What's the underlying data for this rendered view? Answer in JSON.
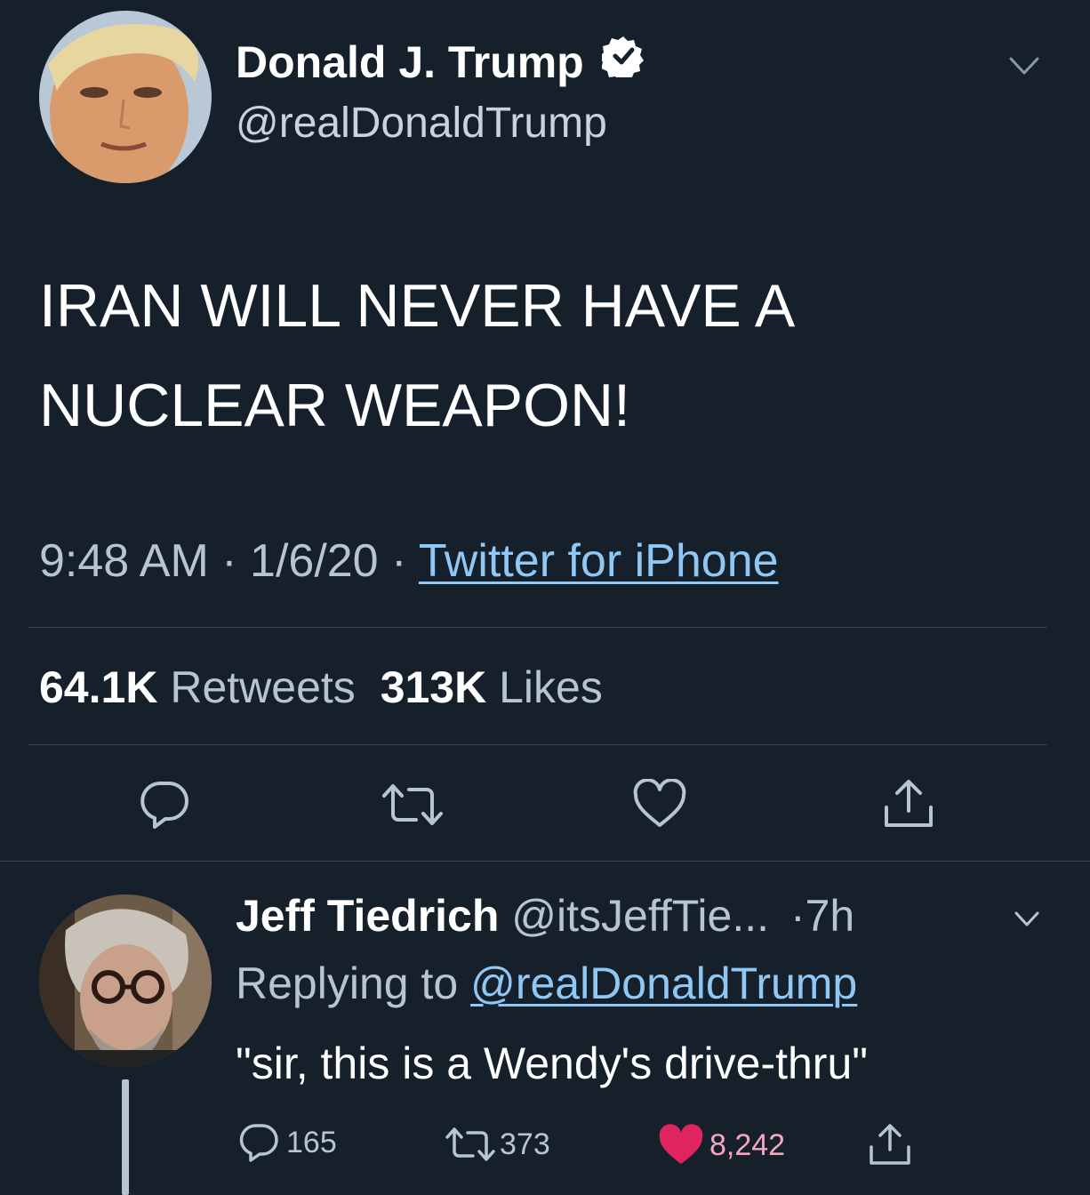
{
  "main_tweet": {
    "author_name": "Donald J. Trump",
    "author_handle": "@realDonaldTrump",
    "verified": true,
    "text_line1": "IRAN WILL NEVER HAVE A",
    "text_line2": "NUCLEAR WEAPON!",
    "time": "9:48 AM",
    "sep1": "·",
    "date": "1/6/20",
    "sep2": "·",
    "source": "Twitter for iPhone",
    "retweets_count": "64.1K",
    "retweets_label": "Retweets",
    "likes_count": "313K",
    "likes_label": "Likes",
    "actions": [
      "reply-icon",
      "retweet-icon",
      "like-icon",
      "share-icon"
    ]
  },
  "reply": {
    "author_name": "Jeff Tiedrich",
    "author_handle": "@itsJeffTie...",
    "time": "·7h",
    "replying_label": "Replying to",
    "replying_to": "@realDonaldTrump",
    "text": "\"sir, this is a Wendy's drive-thru\"",
    "reply_count": "165",
    "retweet_count": "373",
    "like_count": "8,242",
    "liked": true
  },
  "colors": {
    "background": "#15202b",
    "link": "#8fc7f5",
    "muted": "#8899a6",
    "divider": "#38444d",
    "like_active": "#e0245e"
  }
}
